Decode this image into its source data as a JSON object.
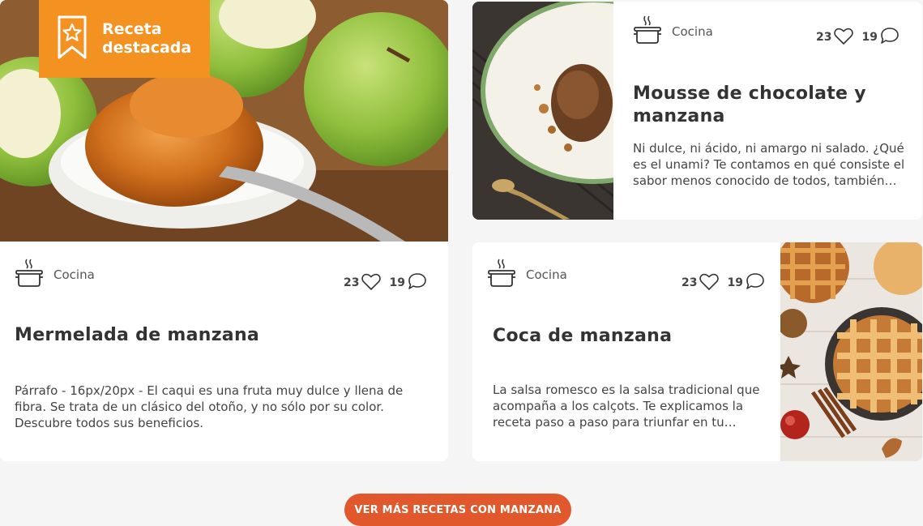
{
  "featured": {
    "badge": "Receta destacada",
    "category": "Cocina",
    "likes": "23",
    "comments": "19",
    "title": "Mermelada de manzana",
    "description": "Párrafo - 16px/20px - El caqui es una fruta muy dulce y llena de fibra. Se trata de un clásico del otoño, y no sólo por su color. Descubre todos sus beneficios."
  },
  "cards": [
    {
      "category": "Cocina",
      "likes": "23",
      "comments": "19",
      "title": "Mousse de chocolate y manzana",
      "description": "Ni dulce, ni ácido, ni amargo ni salado. ¿Qué es el unami? Te contamos en qué consiste el sabor menos conocido de todos, también…"
    },
    {
      "category": "Cocina",
      "likes": "23",
      "comments": "19",
      "title": "Coca de manzana",
      "description": "La salsa romesco es la salsa tradicional que acompaña a los calçots. Te explicamos la receta paso a paso para triunfar en tu…"
    }
  ],
  "cta_label": "VER MÁS RECETAS CON MANZANA",
  "colors": {
    "badge": "#f39221",
    "cta": "#e0582c",
    "background": "#f5f5f5"
  },
  "icons": [
    "bookmark-star-icon",
    "pot-icon",
    "heart-icon",
    "comment-icon"
  ]
}
